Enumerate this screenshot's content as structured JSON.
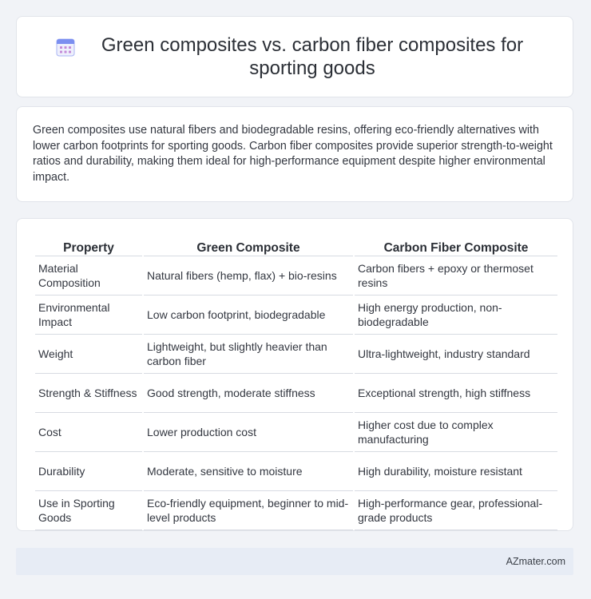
{
  "header": {
    "title": "Green composites vs. carbon fiber composites for sporting goods",
    "icon": "calendar-icon"
  },
  "summary": {
    "text": "Green composites use natural fibers and biodegradable resins, offering eco-friendly alternatives with lower carbon footprints for sporting goods. Carbon fiber composites provide superior strength-to-weight ratios and durability, making them ideal for high-performance equipment despite higher environmental impact."
  },
  "table": {
    "headers": [
      "Property",
      "Green Composite",
      "Carbon Fiber Composite"
    ],
    "rows": [
      [
        "Material Composition",
        "Natural fibers (hemp, flax) + bio-resins",
        "Carbon fibers + epoxy or thermoset resins"
      ],
      [
        "Environmental Impact",
        "Low carbon footprint, biodegradable",
        "High energy production, non-biodegradable"
      ],
      [
        "Weight",
        "Lightweight, but slightly heavier than carbon fiber",
        "Ultra-lightweight, industry standard"
      ],
      [
        "Strength & Stiffness",
        "Good strength, moderate stiffness",
        "Exceptional strength, high stiffness"
      ],
      [
        "Cost",
        "Lower production cost",
        "Higher cost due to complex manufacturing"
      ],
      [
        "Durability",
        "Moderate, sensitive to moisture",
        "High durability, moisture resistant"
      ],
      [
        "Use in Sporting Goods",
        "Eco-friendly equipment, beginner to mid-level products",
        "High-performance gear, professional-grade products"
      ]
    ]
  },
  "footer": {
    "site": "AZmater.com"
  },
  "colors": {
    "background": "#f1f3f7",
    "card": "#ffffff",
    "footer": "#e7ecf5",
    "icon_accent": "#7b8ff0"
  }
}
